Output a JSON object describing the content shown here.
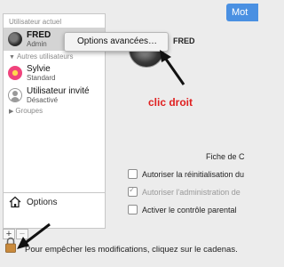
{
  "window": {
    "tab_label": "Mot"
  },
  "sidebar": {
    "current_user_label": "Utilisateur actuel",
    "current_user": {
      "name": "FRED",
      "role": "Admin"
    },
    "other_users_label": "Autres utilisateurs",
    "other_users": [
      {
        "name": "Sylvie",
        "role": "Standard"
      },
      {
        "name": "Utilisateur invité",
        "role": "Désactivé"
      }
    ],
    "groups_label": "Groupes",
    "options_label": "Options",
    "add_label": "+",
    "remove_label": "−"
  },
  "context_menu": {
    "item": "Options avancées…"
  },
  "right_pane": {
    "user_name": "FRED",
    "annotation": "clic droit",
    "fiche_label": "Fiche de C",
    "checkboxes": [
      {
        "label": "Autoriser la réinitialisation du",
        "checked": false,
        "disabled": false
      },
      {
        "label": "Autoriser l'administration de",
        "checked": true,
        "disabled": true
      },
      {
        "label": "Activer le contrôle parental",
        "checked": false,
        "disabled": false
      }
    ]
  },
  "footer": {
    "lock_text": "Pour empêcher les modifications, cliquez sur le cadenas."
  },
  "colors": {
    "annotation": "#e02020",
    "accent": "#4a90e2"
  },
  "icons": [
    "house-icon",
    "lock-icon",
    "arrow-icon"
  ]
}
